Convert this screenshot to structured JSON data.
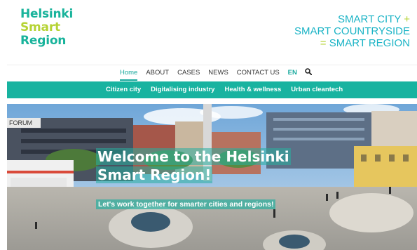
{
  "logo": {
    "line1": "Helsinki",
    "line2": "Smart",
    "line3": "Region"
  },
  "tagline": {
    "line1": "SMART CITY",
    "plus": "+",
    "line2": "SMART COUNTRYSIDE",
    "equals": "=",
    "line3": "SMART REGION"
  },
  "nav": {
    "items": [
      {
        "label": "Home"
      },
      {
        "label": "ABOUT"
      },
      {
        "label": "CASES"
      },
      {
        "label": "NEWS"
      },
      {
        "label": "CONTACT US"
      }
    ],
    "lang": "EN",
    "search_icon": "search-icon"
  },
  "subnav": {
    "items": [
      {
        "label": "Citizen city"
      },
      {
        "label": "Digitalising industry"
      },
      {
        "label": "Health & wellness"
      },
      {
        "label": "Urban cleantech"
      }
    ]
  },
  "hero": {
    "title": "Welcome to the Helsinki Smart Region!",
    "subtitle": "Let's work together for smarter cities and regions!",
    "sign_text": "FORUM"
  },
  "colors": {
    "teal": "#18b3a0",
    "lime": "#b5d334",
    "cyan": "#1cb4c6"
  }
}
